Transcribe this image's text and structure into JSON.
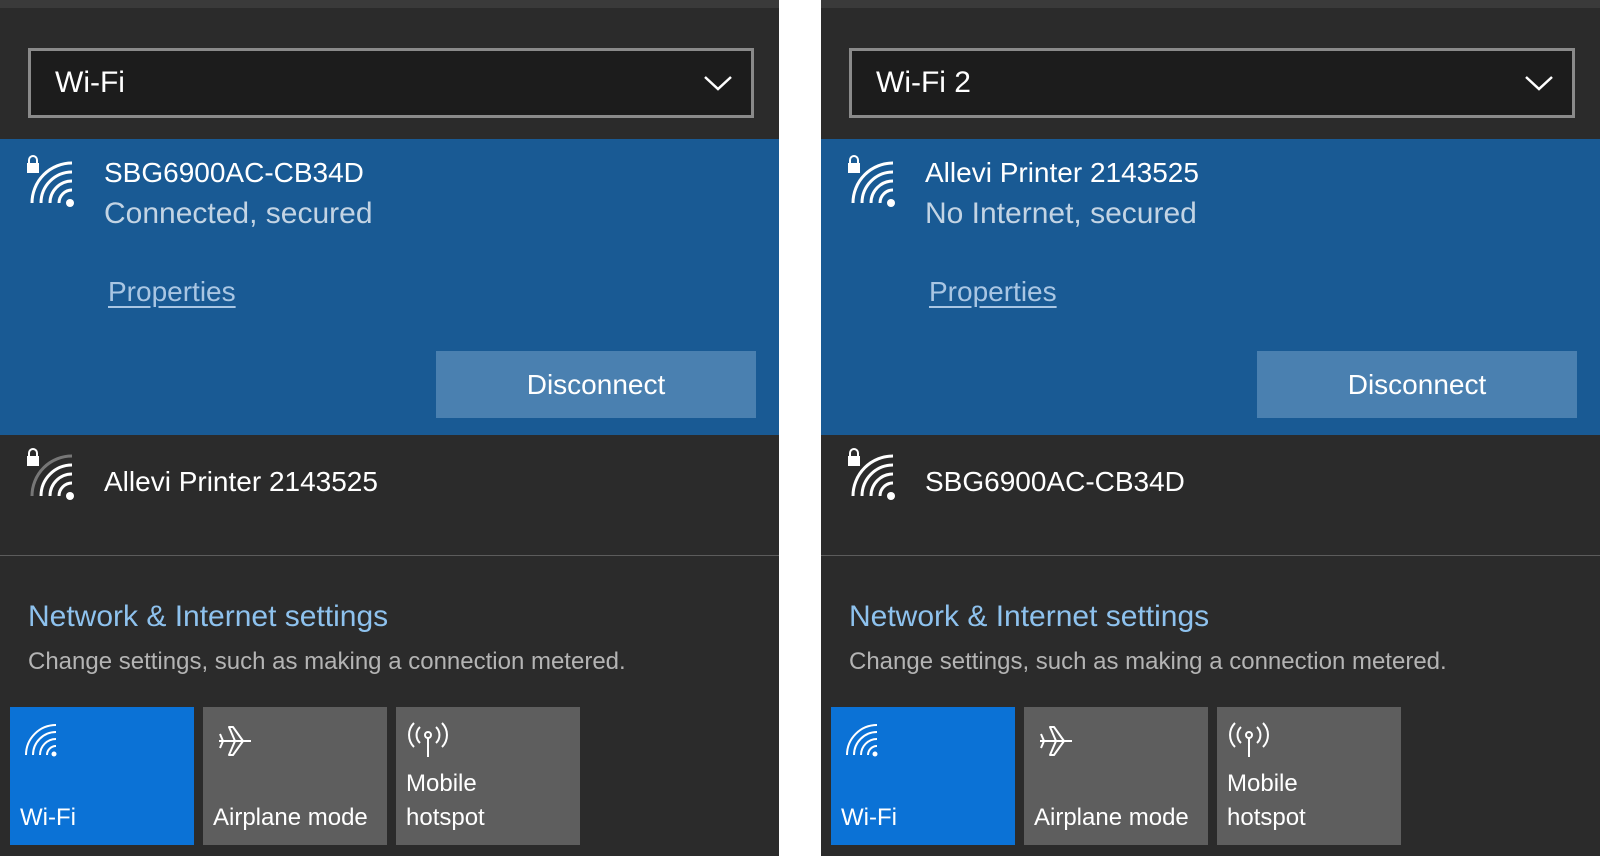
{
  "colors": {
    "panel_bg": "#2b2b2b",
    "connected_bg": "#195a94",
    "disconnect_bg": "#4a80b0",
    "link": "#8ec2ee",
    "tile_active": "#0b72d6",
    "tile_inactive": "#5e5e5e"
  },
  "panels": [
    {
      "adapter": "Wi-Fi",
      "connected": {
        "name": "SBG6900AC-CB34D",
        "status": "Connected, secured",
        "properties": "Properties",
        "disconnect": "Disconnect"
      },
      "other": {
        "name": "Allevi Printer 2143525"
      },
      "settings": {
        "title": "Network & Internet settings",
        "desc": "Change settings, such as making a connection metered."
      },
      "tiles": [
        {
          "label": "Wi-Fi",
          "icon": "wifi-icon",
          "active": true
        },
        {
          "label": "Airplane mode",
          "icon": "airplane-icon",
          "active": false
        },
        {
          "label": "Mobile\nhotspot",
          "icon": "hotspot-icon",
          "active": false
        }
      ]
    },
    {
      "adapter": "Wi-Fi 2",
      "connected": {
        "name": "Allevi Printer 2143525",
        "status": "No Internet, secured",
        "properties": "Properties",
        "disconnect": "Disconnect"
      },
      "other": {
        "name": "SBG6900AC-CB34D"
      },
      "settings": {
        "title": "Network & Internet settings",
        "desc": "Change settings, such as making a connection metered."
      },
      "tiles": [
        {
          "label": "Wi-Fi",
          "icon": "wifi-icon",
          "active": true
        },
        {
          "label": "Airplane mode",
          "icon": "airplane-icon",
          "active": false
        },
        {
          "label": "Mobile\nhotspot",
          "icon": "hotspot-icon",
          "active": false
        }
      ]
    }
  ]
}
